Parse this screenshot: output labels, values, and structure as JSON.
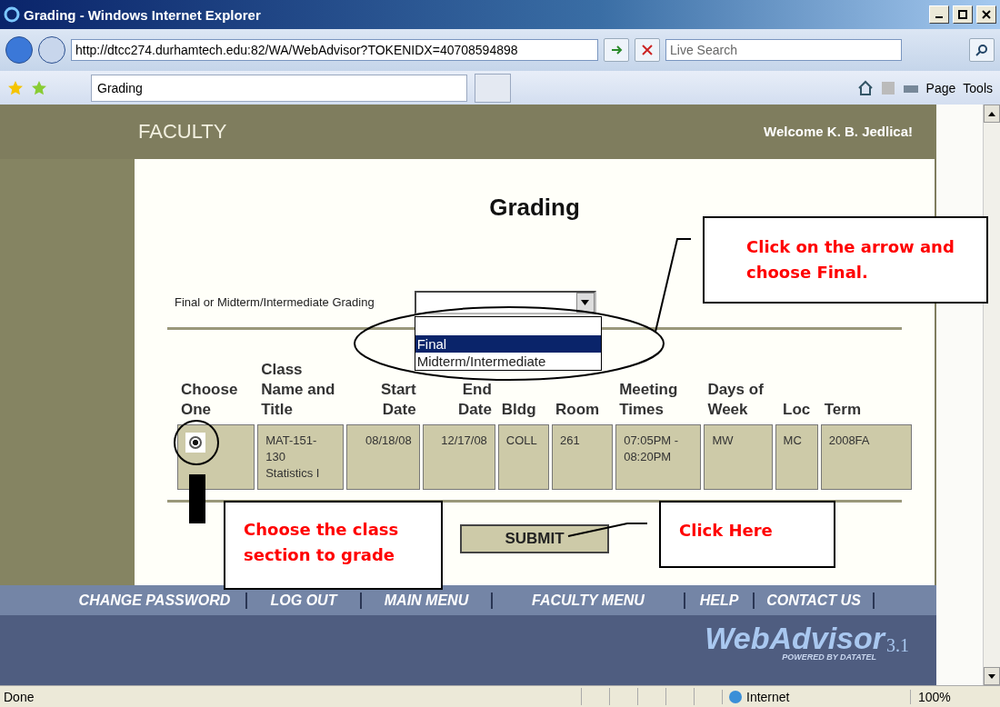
{
  "window": {
    "title": "Grading - Windows Internet Explorer"
  },
  "address_bar": {
    "url": "http://dtcc274.durhamtech.edu:82/WA/WebAdvisor?TOKENIDX=40708594898"
  },
  "search": {
    "placeholder": "Live Search"
  },
  "tabs": [
    {
      "label": "Grading",
      "selected": true
    }
  ],
  "command_bar": [
    "Page",
    "Tools"
  ],
  "header": {
    "title": "FACULTY",
    "welcome": "Welcome K. B. Jedlica!"
  },
  "page_title": "Grading",
  "grading_select": {
    "label": "Final or Midterm/Intermediate Grading",
    "options": [
      {
        "label": "Final",
        "selected": true
      },
      {
        "label": "Midterm/Intermediate",
        "selected": false
      }
    ]
  },
  "table": {
    "columns": [
      "Choose One",
      "Class Name and Title",
      "Start Date",
      "End Date",
      "Bldg",
      "Room",
      "Meeting Times",
      "Days of Week",
      "Loc",
      "Term"
    ],
    "rows": [
      {
        "selected": true,
        "cells": [
          "",
          "MAT-151-130 Statistics I",
          "08/18/08",
          "12/17/08",
          "COLL",
          "261",
          "07:05PM - 08:20PM",
          "MW",
          "MC",
          "2008FA"
        ]
      }
    ]
  },
  "submit": "SUBMIT",
  "callouts": [
    {
      "text": "Click on the arrow and choose Final."
    },
    {
      "text": "Choose the class section to grade"
    },
    {
      "text": "Click Here"
    }
  ],
  "nav": [
    "CHANGE PASSWORD",
    "LOG OUT",
    "MAIN MENU",
    "FACULTY MENU",
    "HELP",
    "CONTACT US"
  ],
  "logo": {
    "name": "WebAdvisor",
    "version": "3.1",
    "tagline": "POWERED BY DATATEL"
  },
  "status_bar": {
    "text": "Done",
    "zone": "Internet",
    "zoom": "100%"
  }
}
